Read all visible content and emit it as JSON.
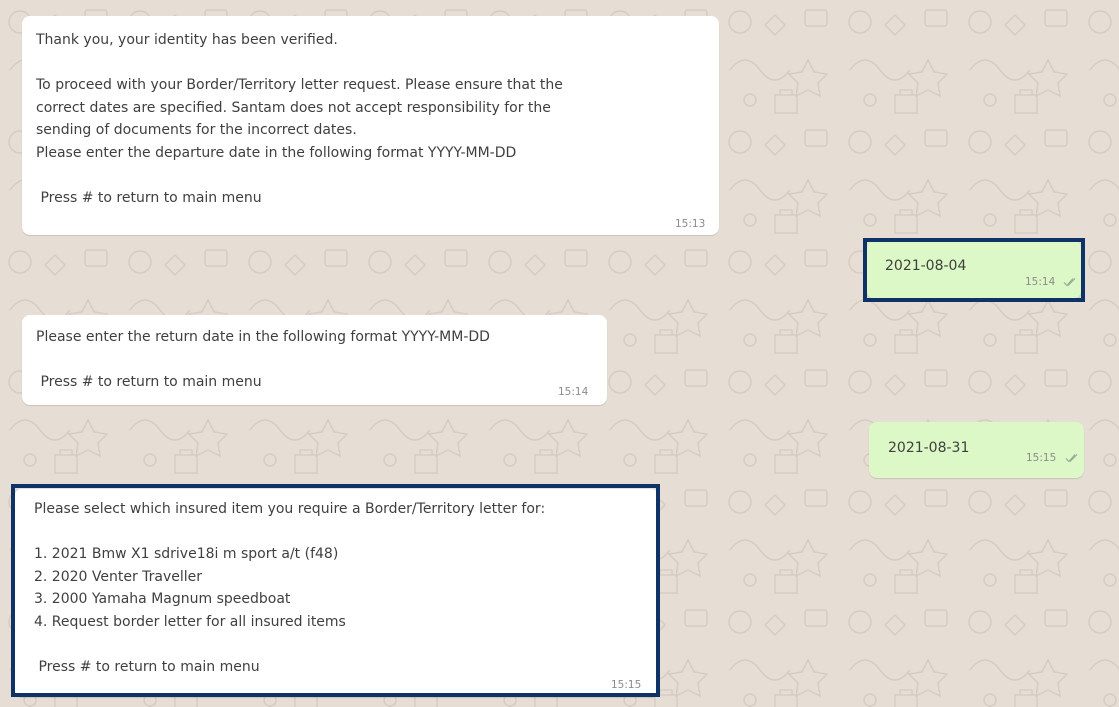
{
  "colors": {
    "wallpaper": "#e6ded4",
    "incoming_bubble": "#ffffff",
    "outgoing_bubble": "#dcf8c6",
    "highlight_border": "#0f3366",
    "text": "#3f3f3f",
    "timestamp": "#8c8c8c"
  },
  "messages": [
    {
      "direction": "incoming",
      "lines": [
        "Thank you, your identity has been verified.",
        "",
        "To proceed with your Border/Territory letter request. Please ensure that the",
        "correct dates are specified. Santam does not accept responsibility for the",
        "sending of documents for the incorrect dates.",
        "Please enter the departure date in the following format YYYY-MM-DD",
        "",
        " Press # to return to main menu"
      ],
      "time": "15:13"
    },
    {
      "direction": "outgoing",
      "lines": [
        "2021-08-04"
      ],
      "time": "15:14",
      "status_icon": "double-check-icon",
      "highlighted": true
    },
    {
      "direction": "incoming",
      "lines": [
        "Please enter the return date in the following format YYYY-MM-DD",
        "",
        " Press # to return to main menu"
      ],
      "time": "15:14"
    },
    {
      "direction": "outgoing",
      "lines": [
        "2021-08-31"
      ],
      "time": "15:15",
      "status_icon": "double-check-icon"
    },
    {
      "direction": "incoming",
      "lines": [
        "Please select which insured item you require a Border/Territory letter for:",
        "",
        "1. 2021 Bmw X1 sdrive18i m sport a/t (f48)",
        "2. 2020 Venter Traveller",
        "3. 2000 Yamaha Magnum speedboat",
        "4. Request border letter for all insured items",
        "",
        " Press # to return to main menu"
      ],
      "time": "15:15",
      "highlighted": true
    }
  ]
}
